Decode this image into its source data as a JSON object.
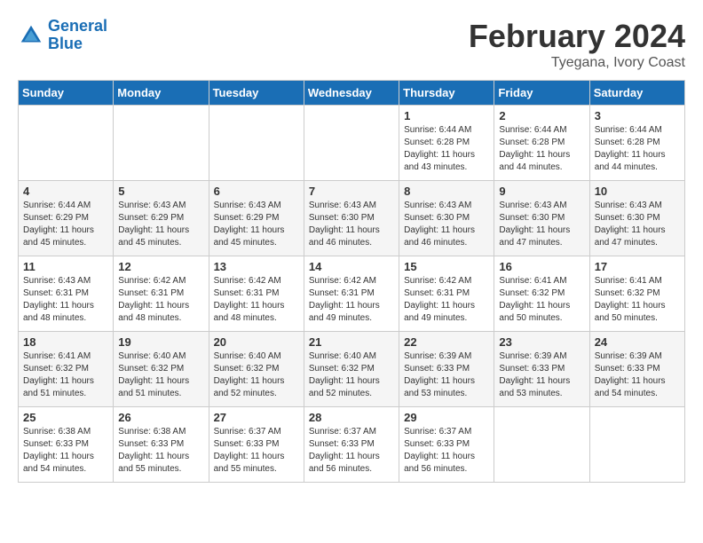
{
  "header": {
    "logo_line1": "General",
    "logo_line2": "Blue",
    "calendar_title": "February 2024",
    "calendar_subtitle": "Tyegana, Ivory Coast"
  },
  "columns": [
    "Sunday",
    "Monday",
    "Tuesday",
    "Wednesday",
    "Thursday",
    "Friday",
    "Saturday"
  ],
  "weeks": [
    [
      {
        "day": "",
        "sunrise": "",
        "sunset": "",
        "daylight": ""
      },
      {
        "day": "",
        "sunrise": "",
        "sunset": "",
        "daylight": ""
      },
      {
        "day": "",
        "sunrise": "",
        "sunset": "",
        "daylight": ""
      },
      {
        "day": "",
        "sunrise": "",
        "sunset": "",
        "daylight": ""
      },
      {
        "day": "1",
        "sunrise": "Sunrise: 6:44 AM",
        "sunset": "Sunset: 6:28 PM",
        "daylight": "Daylight: 11 hours and 43 minutes."
      },
      {
        "day": "2",
        "sunrise": "Sunrise: 6:44 AM",
        "sunset": "Sunset: 6:28 PM",
        "daylight": "Daylight: 11 hours and 44 minutes."
      },
      {
        "day": "3",
        "sunrise": "Sunrise: 6:44 AM",
        "sunset": "Sunset: 6:28 PM",
        "daylight": "Daylight: 11 hours and 44 minutes."
      }
    ],
    [
      {
        "day": "4",
        "sunrise": "Sunrise: 6:44 AM",
        "sunset": "Sunset: 6:29 PM",
        "daylight": "Daylight: 11 hours and 45 minutes."
      },
      {
        "day": "5",
        "sunrise": "Sunrise: 6:43 AM",
        "sunset": "Sunset: 6:29 PM",
        "daylight": "Daylight: 11 hours and 45 minutes."
      },
      {
        "day": "6",
        "sunrise": "Sunrise: 6:43 AM",
        "sunset": "Sunset: 6:29 PM",
        "daylight": "Daylight: 11 hours and 45 minutes."
      },
      {
        "day": "7",
        "sunrise": "Sunrise: 6:43 AM",
        "sunset": "Sunset: 6:30 PM",
        "daylight": "Daylight: 11 hours and 46 minutes."
      },
      {
        "day": "8",
        "sunrise": "Sunrise: 6:43 AM",
        "sunset": "Sunset: 6:30 PM",
        "daylight": "Daylight: 11 hours and 46 minutes."
      },
      {
        "day": "9",
        "sunrise": "Sunrise: 6:43 AM",
        "sunset": "Sunset: 6:30 PM",
        "daylight": "Daylight: 11 hours and 47 minutes."
      },
      {
        "day": "10",
        "sunrise": "Sunrise: 6:43 AM",
        "sunset": "Sunset: 6:30 PM",
        "daylight": "Daylight: 11 hours and 47 minutes."
      }
    ],
    [
      {
        "day": "11",
        "sunrise": "Sunrise: 6:43 AM",
        "sunset": "Sunset: 6:31 PM",
        "daylight": "Daylight: 11 hours and 48 minutes."
      },
      {
        "day": "12",
        "sunrise": "Sunrise: 6:42 AM",
        "sunset": "Sunset: 6:31 PM",
        "daylight": "Daylight: 11 hours and 48 minutes."
      },
      {
        "day": "13",
        "sunrise": "Sunrise: 6:42 AM",
        "sunset": "Sunset: 6:31 PM",
        "daylight": "Daylight: 11 hours and 48 minutes."
      },
      {
        "day": "14",
        "sunrise": "Sunrise: 6:42 AM",
        "sunset": "Sunset: 6:31 PM",
        "daylight": "Daylight: 11 hours and 49 minutes."
      },
      {
        "day": "15",
        "sunrise": "Sunrise: 6:42 AM",
        "sunset": "Sunset: 6:31 PM",
        "daylight": "Daylight: 11 hours and 49 minutes."
      },
      {
        "day": "16",
        "sunrise": "Sunrise: 6:41 AM",
        "sunset": "Sunset: 6:32 PM",
        "daylight": "Daylight: 11 hours and 50 minutes."
      },
      {
        "day": "17",
        "sunrise": "Sunrise: 6:41 AM",
        "sunset": "Sunset: 6:32 PM",
        "daylight": "Daylight: 11 hours and 50 minutes."
      }
    ],
    [
      {
        "day": "18",
        "sunrise": "Sunrise: 6:41 AM",
        "sunset": "Sunset: 6:32 PM",
        "daylight": "Daylight: 11 hours and 51 minutes."
      },
      {
        "day": "19",
        "sunrise": "Sunrise: 6:40 AM",
        "sunset": "Sunset: 6:32 PM",
        "daylight": "Daylight: 11 hours and 51 minutes."
      },
      {
        "day": "20",
        "sunrise": "Sunrise: 6:40 AM",
        "sunset": "Sunset: 6:32 PM",
        "daylight": "Daylight: 11 hours and 52 minutes."
      },
      {
        "day": "21",
        "sunrise": "Sunrise: 6:40 AM",
        "sunset": "Sunset: 6:32 PM",
        "daylight": "Daylight: 11 hours and 52 minutes."
      },
      {
        "day": "22",
        "sunrise": "Sunrise: 6:39 AM",
        "sunset": "Sunset: 6:33 PM",
        "daylight": "Daylight: 11 hours and 53 minutes."
      },
      {
        "day": "23",
        "sunrise": "Sunrise: 6:39 AM",
        "sunset": "Sunset: 6:33 PM",
        "daylight": "Daylight: 11 hours and 53 minutes."
      },
      {
        "day": "24",
        "sunrise": "Sunrise: 6:39 AM",
        "sunset": "Sunset: 6:33 PM",
        "daylight": "Daylight: 11 hours and 54 minutes."
      }
    ],
    [
      {
        "day": "25",
        "sunrise": "Sunrise: 6:38 AM",
        "sunset": "Sunset: 6:33 PM",
        "daylight": "Daylight: 11 hours and 54 minutes."
      },
      {
        "day": "26",
        "sunrise": "Sunrise: 6:38 AM",
        "sunset": "Sunset: 6:33 PM",
        "daylight": "Daylight: 11 hours and 55 minutes."
      },
      {
        "day": "27",
        "sunrise": "Sunrise: 6:37 AM",
        "sunset": "Sunset: 6:33 PM",
        "daylight": "Daylight: 11 hours and 55 minutes."
      },
      {
        "day": "28",
        "sunrise": "Sunrise: 6:37 AM",
        "sunset": "Sunset: 6:33 PM",
        "daylight": "Daylight: 11 hours and 56 minutes."
      },
      {
        "day": "29",
        "sunrise": "Sunrise: 6:37 AM",
        "sunset": "Sunset: 6:33 PM",
        "daylight": "Daylight: 11 hours and 56 minutes."
      },
      {
        "day": "",
        "sunrise": "",
        "sunset": "",
        "daylight": ""
      },
      {
        "day": "",
        "sunrise": "",
        "sunset": "",
        "daylight": ""
      }
    ]
  ]
}
